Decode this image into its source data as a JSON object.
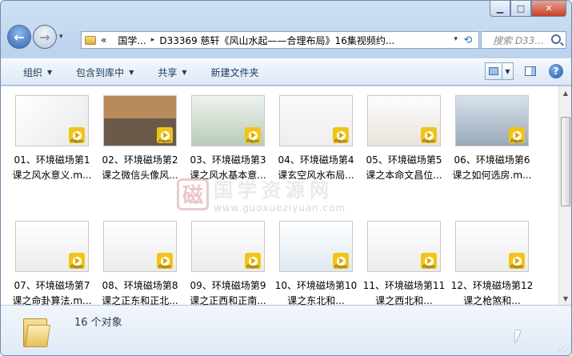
{
  "window": {
    "min_icon": "minimize-icon",
    "max_icon": "maximize-icon",
    "close_icon": "close-icon"
  },
  "nav": {
    "back": "←",
    "forward": "→",
    "dropdown": "▾"
  },
  "address": {
    "prefix": "«",
    "crumb1": "国学...",
    "sep": "▸",
    "crumb2": "D33369 慈轩《风山水起——合理布局》16集视频约...",
    "dd": "▾"
  },
  "search": {
    "placeholder": "搜索 D33..."
  },
  "toolbar": {
    "organize": "组织",
    "include": "包含到库中",
    "share": "共享",
    "newfolder": "新建文件夹",
    "arrow": "▼"
  },
  "files": [
    {
      "label": "01、环境磁场第1课之风水意义.m...",
      "theme": "title-art"
    },
    {
      "label": "02、环境磁场第2课之微信头像风...",
      "theme": "road"
    },
    {
      "label": "03、环境磁场第3课之风水基本意...",
      "theme": "landscape"
    },
    {
      "label": "04、环境磁场第4课玄空风水布局...",
      "theme": "text"
    },
    {
      "label": "05、环境磁场第5课之本命文昌位...",
      "theme": "table"
    },
    {
      "label": "06、环境磁场第6课之如何选房.m...",
      "theme": "buildings"
    },
    {
      "label": "07、环境磁场第7课之命卦算法.m...",
      "theme": "light"
    },
    {
      "label": "08、环境磁场第8课之正东和正北...",
      "theme": "light"
    },
    {
      "label": "09、环境磁场第9课之正西和正南...",
      "theme": "light"
    },
    {
      "label": "10、环境磁场第10课之东北和...",
      "theme": "plan"
    },
    {
      "label": "11、环境磁场第11课之西北和...",
      "theme": "light"
    },
    {
      "label": "12、环境磁场第12课之枪煞和...",
      "theme": "light"
    }
  ],
  "play_label": "Player",
  "status": {
    "count": "16 个对象"
  },
  "watermark": {
    "seal": "磁",
    "line1": "国学资源网",
    "line2": "www.guoxueziyuan.com"
  }
}
